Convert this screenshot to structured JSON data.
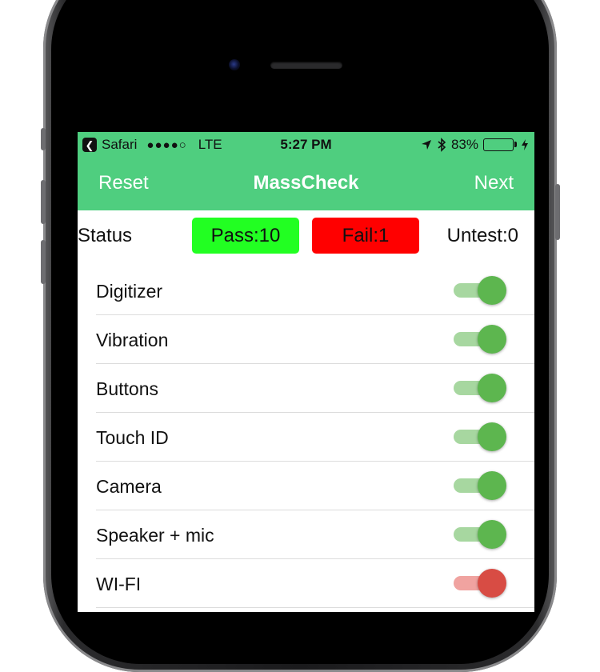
{
  "colors": {
    "nav_bg": "#4fce7f",
    "pass_bg": "#22ff22",
    "fail_bg": "#ff0000",
    "toggle_on": "#5db64f",
    "toggle_off": "#d84c44"
  },
  "statusbar": {
    "back_app": "Safari",
    "signal_dots": "●●●●○",
    "network": "LTE",
    "time": "5:27 PM",
    "battery": "83%"
  },
  "navbar": {
    "left": "Reset",
    "title": "MassCheck",
    "right": "Next"
  },
  "status": {
    "label": "Status",
    "pass": "Pass:10",
    "fail": "Fail:1",
    "untest": "Untest:0"
  },
  "tests": [
    {
      "label": "Digitizer",
      "on": true
    },
    {
      "label": "Vibration",
      "on": true
    },
    {
      "label": "Buttons",
      "on": true
    },
    {
      "label": "Touch ID",
      "on": true
    },
    {
      "label": "Camera",
      "on": true
    },
    {
      "label": "Speaker + mic",
      "on": true
    },
    {
      "label": "WI-FI",
      "on": false
    }
  ]
}
